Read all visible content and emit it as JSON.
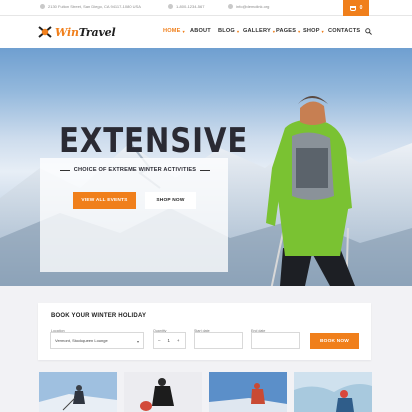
{
  "topbar": {
    "address": "2130 Fulton Street, San Diego, CA 94117-1080 USA",
    "phone": "1-800-1234-567",
    "email": "info@demolink.org",
    "cart_count": "0"
  },
  "header": {
    "logo_part1": "Win",
    "logo_part2": "Travel",
    "nav": [
      {
        "label": "HOME",
        "active": true,
        "has_dropdown": true
      },
      {
        "label": "ABOUT",
        "active": false,
        "has_dropdown": false
      },
      {
        "label": "BLOG",
        "active": false,
        "has_dropdown": true
      },
      {
        "label": "GALLERY",
        "active": false,
        "has_dropdown": true
      },
      {
        "label": "PAGES",
        "active": false,
        "has_dropdown": true
      },
      {
        "label": "SHOP",
        "active": false,
        "has_dropdown": true
      },
      {
        "label": "CONTACTS",
        "active": false,
        "has_dropdown": false
      }
    ],
    "dropdown_glyph": "▾"
  },
  "hero": {
    "headline": "EXTENSIVE",
    "subline": "CHOICE OF EXTREME WINTER ACTIVITIES",
    "primary_button": "VIEW ALL EVENTS",
    "secondary_button": "SHOP NOW"
  },
  "booking": {
    "title": "BOOK YOUR WINTER HOLIDAY",
    "location_label": "Location",
    "location_value": "Vermont, Stockqueen Lounge",
    "quantity_label": "Quantity",
    "quantity_minus": "–",
    "quantity_value": "1",
    "quantity_plus": "+",
    "start_label": "Start date",
    "start_value": "",
    "end_label": "End date",
    "end_value": "",
    "book_button": "BOOK NOW"
  },
  "colors": {
    "accent": "#f07f1b",
    "dark": "#2a2a33",
    "page_bg": "#f2f2f5"
  },
  "icons": [
    "map-pin-icon",
    "phone-icon",
    "email-icon",
    "cart-icon",
    "search-icon",
    "select-arrow-icon"
  ]
}
